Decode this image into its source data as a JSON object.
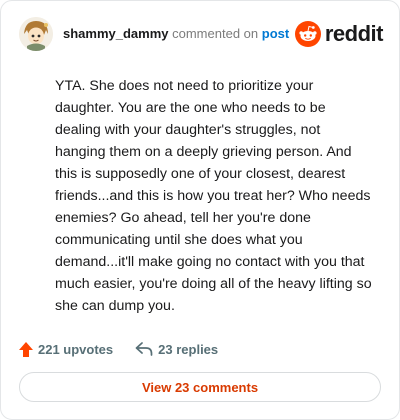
{
  "header": {
    "username": "shammy_dammy",
    "commented_on_text": "commented on",
    "post_link": "post",
    "brand_name": "reddit"
  },
  "comment": {
    "text": "YTA. She does not need to prioritize your daughter. You are the one who needs to be dealing with your daughter's struggles, not hanging them on a deeply grieving person. And this is supposedly one of your closest, dearest friends...and this is how you treat her? Who needs enemies? Go ahead, tell her you're done communicating until she does what you demand...it'll make going no contact with you that much easier, you're doing all of the heavy lifting so she can dump you."
  },
  "actions": {
    "upvotes_label": "221 upvotes",
    "replies_label": "23 replies",
    "view_comments_label": "View 23 comments"
  },
  "icons": {
    "upvote": "upvote-arrow-icon",
    "reply": "reply-arrow-icon",
    "brand": "reddit-snoo-logo",
    "avatar": "user-avatar"
  },
  "colors": {
    "brand_orange": "#ff4500",
    "upvote_orange": "#ff4500",
    "link_blue": "#0079d3",
    "view_button_text": "#d93a00",
    "muted_gray": "#576f76"
  }
}
